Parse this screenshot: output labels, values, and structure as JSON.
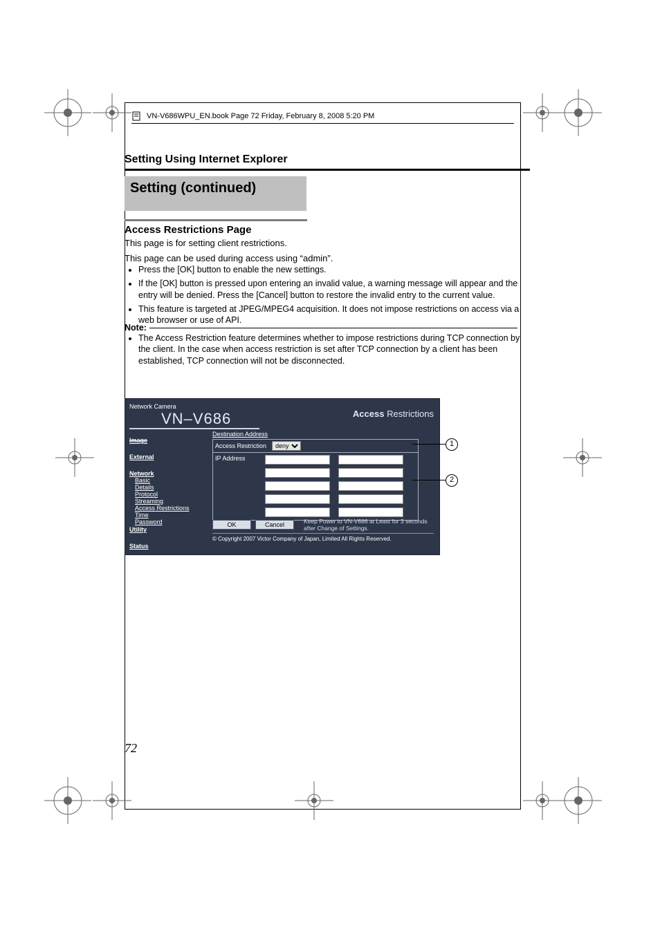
{
  "page_header": "VN-V686WPU_EN.book  Page 72  Friday, February 8, 2008  5:20 PM",
  "section_heading": "Setting Using Internet Explorer",
  "title_block": "Setting (continued)",
  "subhead": "Access Restrictions Page",
  "intro1": "This page is for setting client restrictions.",
  "intro2": "This page can be used during access using “admin”.",
  "bullets_main": [
    "Press the [OK] button to enable the new settings.",
    "If the [OK] button is pressed upon entering an invalid value, a warning message will appear and the entry will be denied. Press the [Cancel] button to restore the invalid entry to the current value.",
    "This feature is targeted at JPEG/MPEG4 acquisition. It does not impose restrictions on access via a web browser or use of API."
  ],
  "note_label": "Note:",
  "note_bullet": "The Access Restriction feature determines whether to impose restrictions during TCP connection by the client. In the case when access restriction is set after TCP connection by a client has been established, TCP connection will not be disconnected.",
  "ui": {
    "top_left": "Network Camera",
    "model": "VN–V686",
    "page_title_prefix": "Access",
    "page_title_rest": " Restrictions",
    "sidebar": {
      "image": "Image",
      "external": "External",
      "network": "Network",
      "basic": "Basic",
      "details": "Details",
      "protocol": "Protocol",
      "streaming": "Streaming",
      "access_restrictions": "Access Restrictions",
      "time": "Time",
      "password": "Password",
      "utility": "Utility",
      "status": "Status"
    },
    "dest_hdr": "Destination Address",
    "row_label": "Access Restriction",
    "select_value": "deny",
    "ip_label": "IP Address",
    "ok": "OK",
    "cancel": "Cancel",
    "hint": "Keep Power to VN-V686 at Least for 3 seconds after Change of Settings.",
    "copyright": "© Copyright 2007 Victor Company of Japan, Limited All Rights Reserved."
  },
  "callouts": {
    "c1": "1",
    "c2": "2"
  },
  "page_number": "72"
}
